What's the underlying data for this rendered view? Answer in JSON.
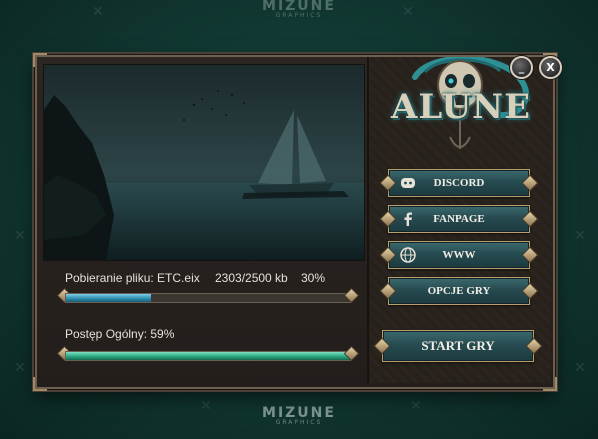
{
  "watermark": {
    "brand": "MIZUNE",
    "sub": "GRAPHICS"
  },
  "logo": {
    "title": "ALUNE"
  },
  "window_controls": {
    "minimize": "_",
    "close": "X"
  },
  "download": {
    "label": "Pobieranie pliku: ETC.eix",
    "size": "2303/2500 kb",
    "percent_text": "30%",
    "progress": 0.3,
    "fill_color": "#2e8fb0"
  },
  "overall": {
    "label": "Postęp Ogólny: 59%",
    "progress": 1.0,
    "fill_color": "#2aa882"
  },
  "menu": {
    "discord": "DISCORD",
    "fanpage": "FANPAGE",
    "www": "WWW",
    "options": "OPCJE GRY",
    "start": "START GRY"
  },
  "icons": {
    "discord": "discord-icon",
    "fanpage": "facebook-icon",
    "www": "globe-icon"
  }
}
